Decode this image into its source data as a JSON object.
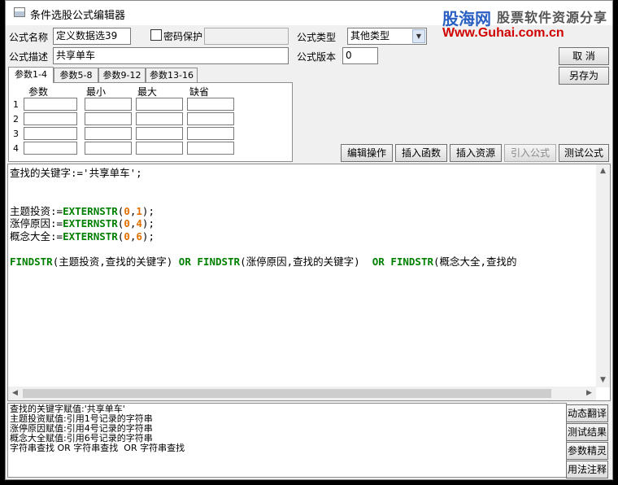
{
  "window": {
    "title": "条件选股公式编辑器"
  },
  "watermark": {
    "brand": "股海网",
    "slogan": "股票软件资源分享",
    "url": "Www.Guhai.com.cn"
  },
  "form": {
    "name_label": "公式名称",
    "name_value": "定义数据选39",
    "password_label": "密码保护",
    "password_value": "",
    "type_label": "公式类型",
    "type_value": "其他类型",
    "desc_label": "公式描述",
    "desc_value": "共享单车",
    "version_label": "公式版本",
    "version_value": "0"
  },
  "buttons": {
    "cancel": "取  消",
    "save_as": "另存为"
  },
  "param_tabs": [
    "参数1-4",
    "参数5-8",
    "参数9-12",
    "参数13-16"
  ],
  "param_table": {
    "headers": [
      "参数",
      "最小",
      "最大",
      "缺省"
    ],
    "rows": [
      "1",
      "2",
      "3",
      "4"
    ]
  },
  "toolbar": {
    "edit_ops": "编辑操作",
    "insert_func": "插入函数",
    "insert_res": "插入资源",
    "import_formula": "引入公式",
    "test_formula": "测试公式"
  },
  "code": {
    "line1": "查找的关键字:='共享单车';",
    "line2_var": "主题投资:=",
    "line3_var": "涨停原因:=",
    "line4_var": "概念大全:=",
    "func_ext": "EXTERNSTR",
    "arg_zero": "0",
    "arg_1": "1",
    "arg_4": "4",
    "arg_6": "6",
    "func_find": "FINDSTR",
    "op_or": "OR",
    "find_args1": "(主题投资,查找的关键字)",
    "find_args2": "(涨停原因,查找的关键字)",
    "find_args3": "(概念大全,查找的",
    "open_paren": "(",
    "comma": ",",
    "close_paren": ");"
  },
  "messages": [
    "查找的关键字赋值:'共享单车'",
    "主题投资赋值:引用1号记录的字符串",
    "涨停原因赋值:引用4号记录的字符串",
    "概念大全赋值:引用6号记录的字符串",
    "字符串查找 OR 字符串查找  OR 字符串查找"
  ],
  "side_buttons": {
    "dynamic_translate": "动态翻译",
    "test_result": "测试结果",
    "param_wizard": "参数精灵",
    "usage_notes": "用法注释"
  },
  "colors": {
    "keyword": "#008000",
    "number": "#e07000",
    "watermark_blue": "#2a5fc4",
    "watermark_red": "#d00000"
  }
}
